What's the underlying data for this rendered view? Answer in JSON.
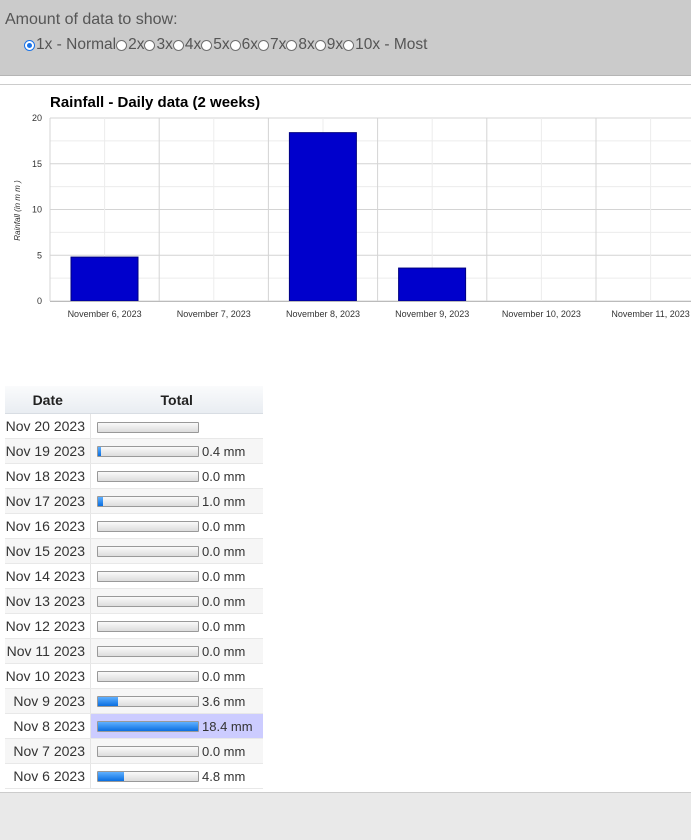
{
  "controls": {
    "label": "Amount of data to show:",
    "options": [
      "1x - Normal",
      "2x",
      "3x",
      "4x",
      "5x",
      "6x",
      "7x",
      "8x",
      "9x",
      "10x - Most"
    ],
    "selected_index": 0
  },
  "chart_data": {
    "type": "bar",
    "title": "Rainfall - Daily data (2 weeks)",
    "ylabel": "Rainfall (in m m )",
    "xlabel": "",
    "ylim": [
      0,
      20
    ],
    "yticks": [
      0,
      5,
      10,
      15,
      20
    ],
    "categories": [
      "November 6, 2023",
      "November 7, 2023",
      "November 8, 2023",
      "November 9, 2023",
      "November 10, 2023",
      "November 11, 2023"
    ],
    "values": [
      4.8,
      0,
      18.4,
      3.6,
      0,
      0
    ],
    "bar_color": "#0000cc",
    "grid": true
  },
  "table": {
    "columns": [
      "Date",
      "Total"
    ],
    "max_value": 18.4,
    "rows": [
      {
        "date": "Nov 20 2023",
        "value": null,
        "label": ""
      },
      {
        "date": "Nov 19 2023",
        "value": 0.4,
        "label": "0.4 mm"
      },
      {
        "date": "Nov 18 2023",
        "value": 0.0,
        "label": "0.0 mm"
      },
      {
        "date": "Nov 17 2023",
        "value": 1.0,
        "label": "1.0 mm"
      },
      {
        "date": "Nov 16 2023",
        "value": 0.0,
        "label": "0.0 mm"
      },
      {
        "date": "Nov 15 2023",
        "value": 0.0,
        "label": "0.0 mm"
      },
      {
        "date": "Nov 14 2023",
        "value": 0.0,
        "label": "0.0 mm"
      },
      {
        "date": "Nov 13 2023",
        "value": 0.0,
        "label": "0.0 mm"
      },
      {
        "date": "Nov 12 2023",
        "value": 0.0,
        "label": "0.0 mm"
      },
      {
        "date": "Nov 11 2023",
        "value": 0.0,
        "label": "0.0 mm"
      },
      {
        "date": "Nov 10 2023",
        "value": 0.0,
        "label": "0.0 mm"
      },
      {
        "date": "Nov 9 2023",
        "value": 3.6,
        "label": "3.6 mm"
      },
      {
        "date": "Nov 8 2023",
        "value": 18.4,
        "label": "18.4 mm",
        "highlight": true
      },
      {
        "date": "Nov 7 2023",
        "value": 0.0,
        "label": "0.0 mm"
      },
      {
        "date": "Nov 6 2023",
        "value": 4.8,
        "label": "4.8 mm"
      }
    ]
  }
}
